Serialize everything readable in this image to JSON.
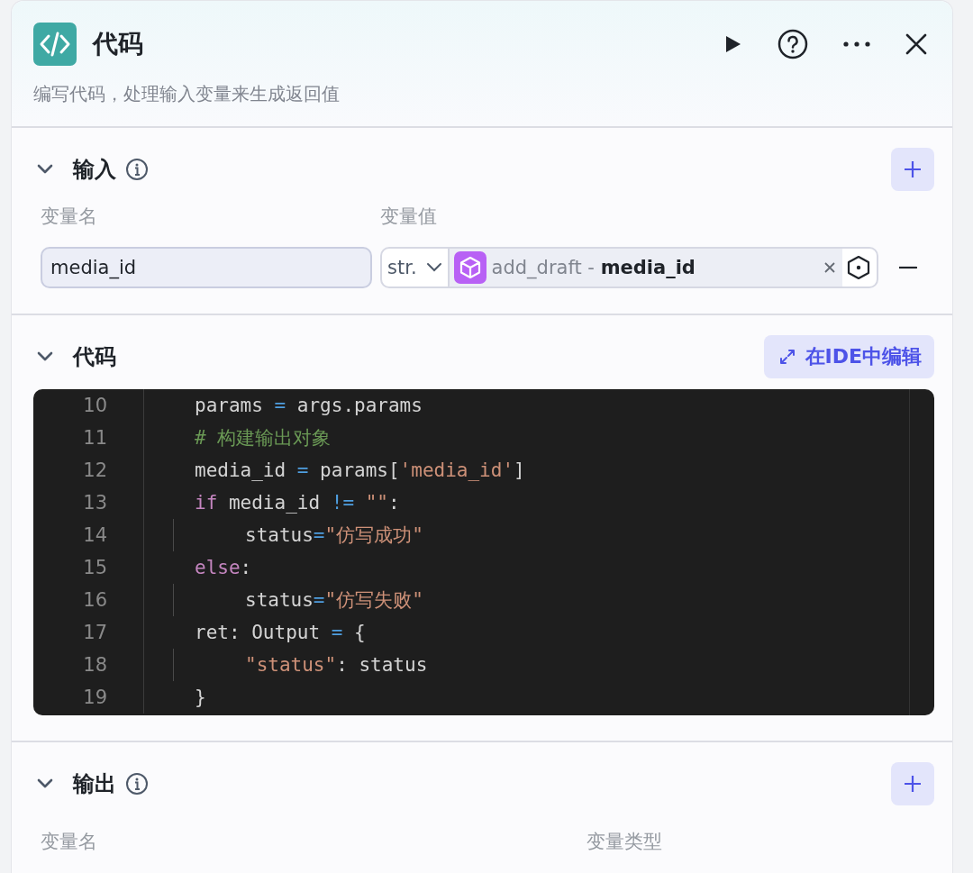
{
  "header": {
    "title": "代码",
    "description": "编写代码，处理输入变量来生成返回值"
  },
  "input_section": {
    "title": "输入",
    "expanded": true,
    "columns": [
      "变量名",
      "变量值"
    ],
    "rows": [
      {
        "name": "media_id",
        "type": "str.",
        "ref_node": "add_draft",
        "separator": "-",
        "ref_field": "media_id"
      }
    ]
  },
  "code_section": {
    "title": "代码",
    "expanded": true,
    "ide_button": "在IDE中编辑",
    "lines": [
      {
        "number": "10",
        "indented": false,
        "tokens": [
          {
            "text": "params ",
            "kind": "plain"
          },
          {
            "text": "=",
            "kind": "op"
          },
          {
            "text": " args.params",
            "kind": "plain"
          }
        ]
      },
      {
        "number": "11",
        "indented": false,
        "tokens": [
          {
            "text": "# 构建输出对象",
            "kind": "comment"
          }
        ]
      },
      {
        "number": "12",
        "indented": false,
        "tokens": [
          {
            "text": "media_id ",
            "kind": "plain"
          },
          {
            "text": "=",
            "kind": "op"
          },
          {
            "text": " params[",
            "kind": "plain"
          },
          {
            "text": "'media_id'",
            "kind": "string"
          },
          {
            "text": "]",
            "kind": "plain"
          }
        ]
      },
      {
        "number": "13",
        "indented": false,
        "tokens": [
          {
            "text": "if",
            "kind": "keyword"
          },
          {
            "text": " media_id ",
            "kind": "plain"
          },
          {
            "text": "!=",
            "kind": "op"
          },
          {
            "text": " \"\"",
            "kind": "string"
          },
          {
            "text": ":",
            "kind": "plain"
          }
        ]
      },
      {
        "number": "14",
        "indented": true,
        "tokens": [
          {
            "text": "status",
            "kind": "plain"
          },
          {
            "text": "=",
            "kind": "op"
          },
          {
            "text": "\"仿写成功\"",
            "kind": "string"
          }
        ]
      },
      {
        "number": "15",
        "indented": false,
        "tokens": [
          {
            "text": "else",
            "kind": "keyword"
          },
          {
            "text": ":",
            "kind": "plain"
          }
        ]
      },
      {
        "number": "16",
        "indented": true,
        "tokens": [
          {
            "text": "status",
            "kind": "plain"
          },
          {
            "text": "=",
            "kind": "op"
          },
          {
            "text": "\"仿写失败\"",
            "kind": "string"
          }
        ]
      },
      {
        "number": "17",
        "indented": false,
        "tokens": [
          {
            "text": "ret: Output ",
            "kind": "plain"
          },
          {
            "text": "=",
            "kind": "op"
          },
          {
            "text": " {",
            "kind": "plain"
          }
        ]
      },
      {
        "number": "18",
        "indented": true,
        "tokens": [
          {
            "text": "\"status\"",
            "kind": "string"
          },
          {
            "text": ": status",
            "kind": "plain"
          }
        ]
      },
      {
        "number": "19",
        "indented": false,
        "tokens": [
          {
            "text": "}",
            "kind": "plain"
          }
        ]
      }
    ]
  },
  "output_section": {
    "title": "输出",
    "expanded": true,
    "columns": [
      "变量名",
      "变量类型"
    ]
  }
}
